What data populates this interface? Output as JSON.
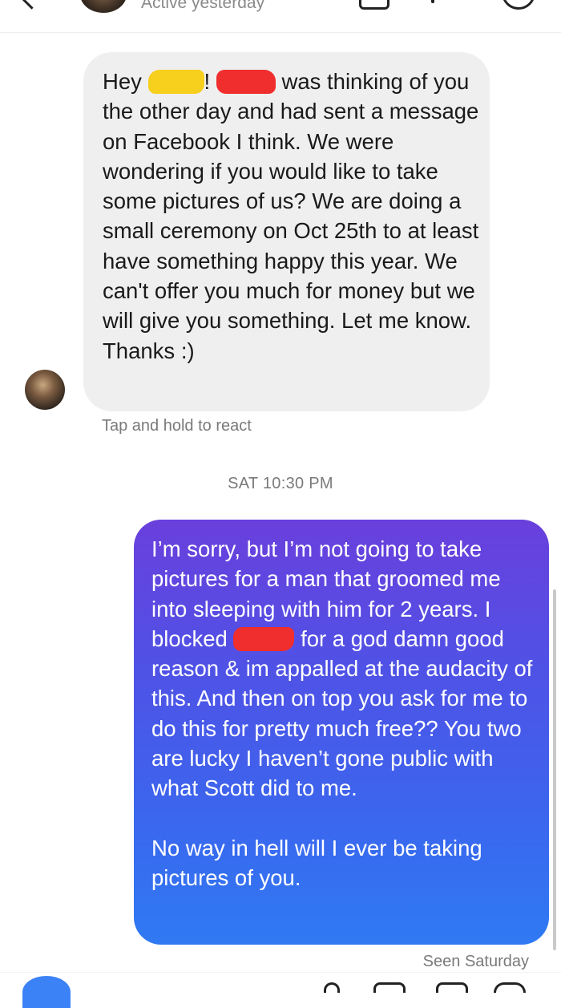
{
  "header": {
    "status": "Active yesterday",
    "icons": [
      "back-chevron-icon",
      "phone-icon",
      "video-icon",
      "info-icon"
    ]
  },
  "messages": {
    "incoming": {
      "greeting": "Hey",
      "exclaim": "!",
      "line1_rest": "was thinking of",
      "body": "you the other day and had sent a message on Facebook I think. We were wondering if you would like to take some pictures of us? We are doing a small ceremony on Oct 25th to at least have something happy this year. We can't offer you much for money but we will give you something. Let me know. Thanks :)",
      "react_hint": "Tap and hold to react"
    },
    "timestamp": "SAT 10:30 PM",
    "outgoing": {
      "part1": "I’m sorry, but I’m not going to take pictures for a man that groomed me into sleeping with him for 2 years. I blocked",
      "part2": "for a god damn good reason & im appalled at the audacity of this. And then on top you ask for me to do this for pretty much free?? You two are lucky I haven’t gone public with what Scott did to me.",
      "part3": "No way in hell will I ever be taking pictures of you.",
      "seen": "Seen Saturday"
    }
  },
  "colors": {
    "incoming_bubble": "#efefef",
    "outgoing_gradient_top": "#6a3fdc",
    "outgoing_gradient_bottom": "#2f7af3",
    "redaction_yellow": "#f7cf1d",
    "redaction_red": "#f02e2e",
    "meta_text": "#7a7a7a"
  }
}
